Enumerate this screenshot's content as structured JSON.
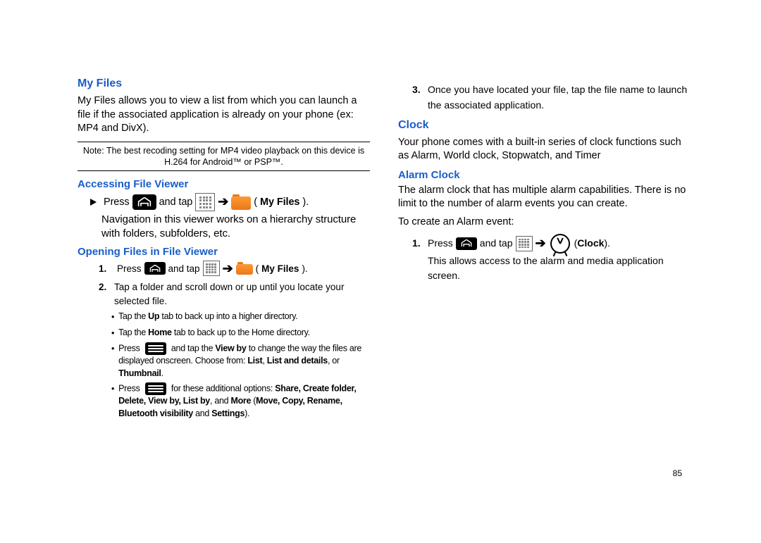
{
  "page_number": "85",
  "left": {
    "h1": "My Files",
    "intro": "My Files allows you to view a list from which you can launch a file if the associated application is already on your phone (ex: MP4 and DivX).",
    "note": "Note: The best recoding setting for MP4 video playback on this device is H.264 for Android™ or PSP™.",
    "h2a": "Accessing File Viewer",
    "afv_press": "Press",
    "afv_andtap": "and tap",
    "afv_arrow": "➔",
    "afv_paren_open": "(",
    "afv_myfiles": "My Files",
    "afv_paren_close": ").",
    "afv_line2": "Navigation in this viewer works on a hierarchy structure with folders, subfolders, etc.",
    "h2b": "Opening Files in File Viewer",
    "step1_num": "1.",
    "step1_press": "Press",
    "step1_andtap": "and tap",
    "step1_arrow": "➔",
    "step1_paren_open": "(",
    "step1_myfiles": "My Files",
    "step1_paren_close": ").",
    "step2_num": "2.",
    "step2_text": "Tap a folder and scroll down or up until you locate your selected file.",
    "b1_pre": "Tap the ",
    "b1_bold": "Up",
    "b1_post": " tab to back up into a higher directory.",
    "b2_pre": "Tap the ",
    "b2_bold": "Home",
    "b2_post": " tab to back up to the Home directory.",
    "b3_press": "Press",
    "b3_mid1": " and tap the ",
    "b3_viewby": "View by",
    "b3_mid2": " to change the way the files are displayed onscreen. Choose from: ",
    "b3_list": "List",
    "b3_comma1": ", ",
    "b3_listdet": "List and details",
    "b3_comma2": ", or ",
    "b3_thumb": "Thumbnail",
    "b3_period": ".",
    "b4_press": "Press",
    "b4_mid1": " for these additional options: ",
    "b4_opts": "Share, Create folder, Delete, View by, List by",
    "b4_and": ", and ",
    "b4_more": "More",
    "b4_paren": " (",
    "b4_opts2": "Move, Copy, Rename, Bluetooth visibility",
    "b4_and2": " and ",
    "b4_settings": "Settings",
    "b4_close": ")."
  },
  "right": {
    "step3_num": "3.",
    "step3_text": "Once you have located your file, tap the file name to launch the associated application.",
    "h_clock": "Clock",
    "clock_body": "Your phone comes with a built-in series of clock functions such as Alarm, World clock, Stopwatch, and Timer",
    "h_alarm": "Alarm Clock",
    "alarm_body": "The alarm clock that has multiple alarm capabilities. There is no limit to the number of alarm events you can create.",
    "alarm_sub": "To create an Alarm event:",
    "r1_num": "1.",
    "r1_press": "Press",
    "r1_andtap": "and tap",
    "r1_arrow": "➔",
    "r1_paren_open": "(",
    "r1_clock": "Clock",
    "r1_paren_close": ").",
    "r1_tail": " This allows access to the alarm and media application screen."
  }
}
